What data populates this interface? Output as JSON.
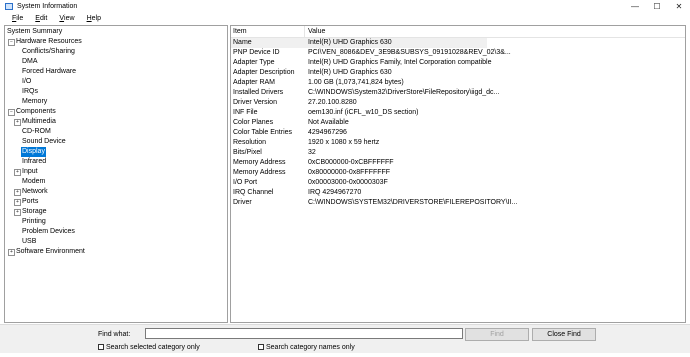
{
  "window": {
    "title": "System Information",
    "minimize_glyph": "—",
    "maximize_glyph": "☐",
    "close_glyph": "✕"
  },
  "menu": [
    {
      "label": "File"
    },
    {
      "label": "Edit"
    },
    {
      "label": "View"
    },
    {
      "label": "Help"
    }
  ],
  "tree": {
    "summary": "System Summary",
    "hardware": "Hardware Resources",
    "hardware_children": [
      "Conflicts/Sharing",
      "DMA",
      "Forced Hardware",
      "I/O",
      "IRQs",
      "Memory"
    ],
    "components": "Components",
    "components_children": [
      "Multimedia",
      "CD-ROM",
      "Sound Device",
      "Display",
      "Infrared",
      "Input",
      "Modem",
      "Network",
      "Ports",
      "Storage",
      "Printing",
      "Problem Devices",
      "USB"
    ],
    "selected": "Display",
    "software": "Software Environment",
    "expanded_glyph": "−",
    "collapsed_glyph": "+"
  },
  "table": {
    "col_item": "Item",
    "col_value": "Value",
    "rows": [
      {
        "item": "Name",
        "value": "Intel(R) UHD Graphics 630"
      },
      {
        "item": "PNP Device ID",
        "value": "PCI\\VEN_8086&DEV_3E9B&SUBSYS_09191028&REV_02\\3&..."
      },
      {
        "item": "Adapter Type",
        "value": "Intel(R) UHD Graphics Family, Intel Corporation compatible"
      },
      {
        "item": "Adapter Description",
        "value": "Intel(R) UHD Graphics 630"
      },
      {
        "item": "Adapter RAM",
        "value": "1.00 GB (1,073,741,824 bytes)"
      },
      {
        "item": "Installed Drivers",
        "value": "C:\\WINDOWS\\System32\\DriverStore\\FileRepository\\iigd_dc..."
      },
      {
        "item": "Driver Version",
        "value": "27.20.100.8280"
      },
      {
        "item": "INF File",
        "value": "oem130.inf (iCFL_w10_DS section)"
      },
      {
        "item": "Color Planes",
        "value": "Not Available"
      },
      {
        "item": "Color Table Entries",
        "value": "4294967296"
      },
      {
        "item": "Resolution",
        "value": "1920 x 1080 x 59 hertz"
      },
      {
        "item": "Bits/Pixel",
        "value": "32"
      },
      {
        "item": "Memory Address",
        "value": "0xCB000000-0xCBFFFFFF"
      },
      {
        "item": "Memory Address",
        "value": "0x80000000-0x8FFFFFFF"
      },
      {
        "item": "I/O Port",
        "value": "0x00003000-0x0000303F"
      },
      {
        "item": "IRQ Channel",
        "value": "IRQ 4294967270"
      },
      {
        "item": "Driver",
        "value": "C:\\WINDOWS\\SYSTEM32\\DRIVERSTORE\\FILEREPOSITORY\\II..."
      }
    ]
  },
  "find": {
    "label": "Find what:",
    "value": "",
    "find_button": "Find",
    "close_button": "Close Find",
    "check_selected": "Search selected category only",
    "check_names": "Search category names only"
  }
}
